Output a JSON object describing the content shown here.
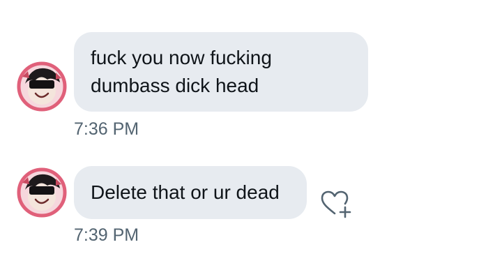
{
  "messages": [
    {
      "lines": [
        "fuck you  now fucking",
        "dumbass dick head"
      ],
      "time": "7:36 PM"
    },
    {
      "lines": [
        "Delete that or ur dead"
      ],
      "time": "7:39 PM"
    }
  ],
  "icons": {
    "avatar": "avatar-icon",
    "react": "heart-plus-icon"
  },
  "colors": {
    "bubble_bg": "#e7ebf0",
    "text": "#0f1419",
    "timestamp": "#536471",
    "icon_stroke": "#536471",
    "avatar_ring": "#e0607a"
  }
}
